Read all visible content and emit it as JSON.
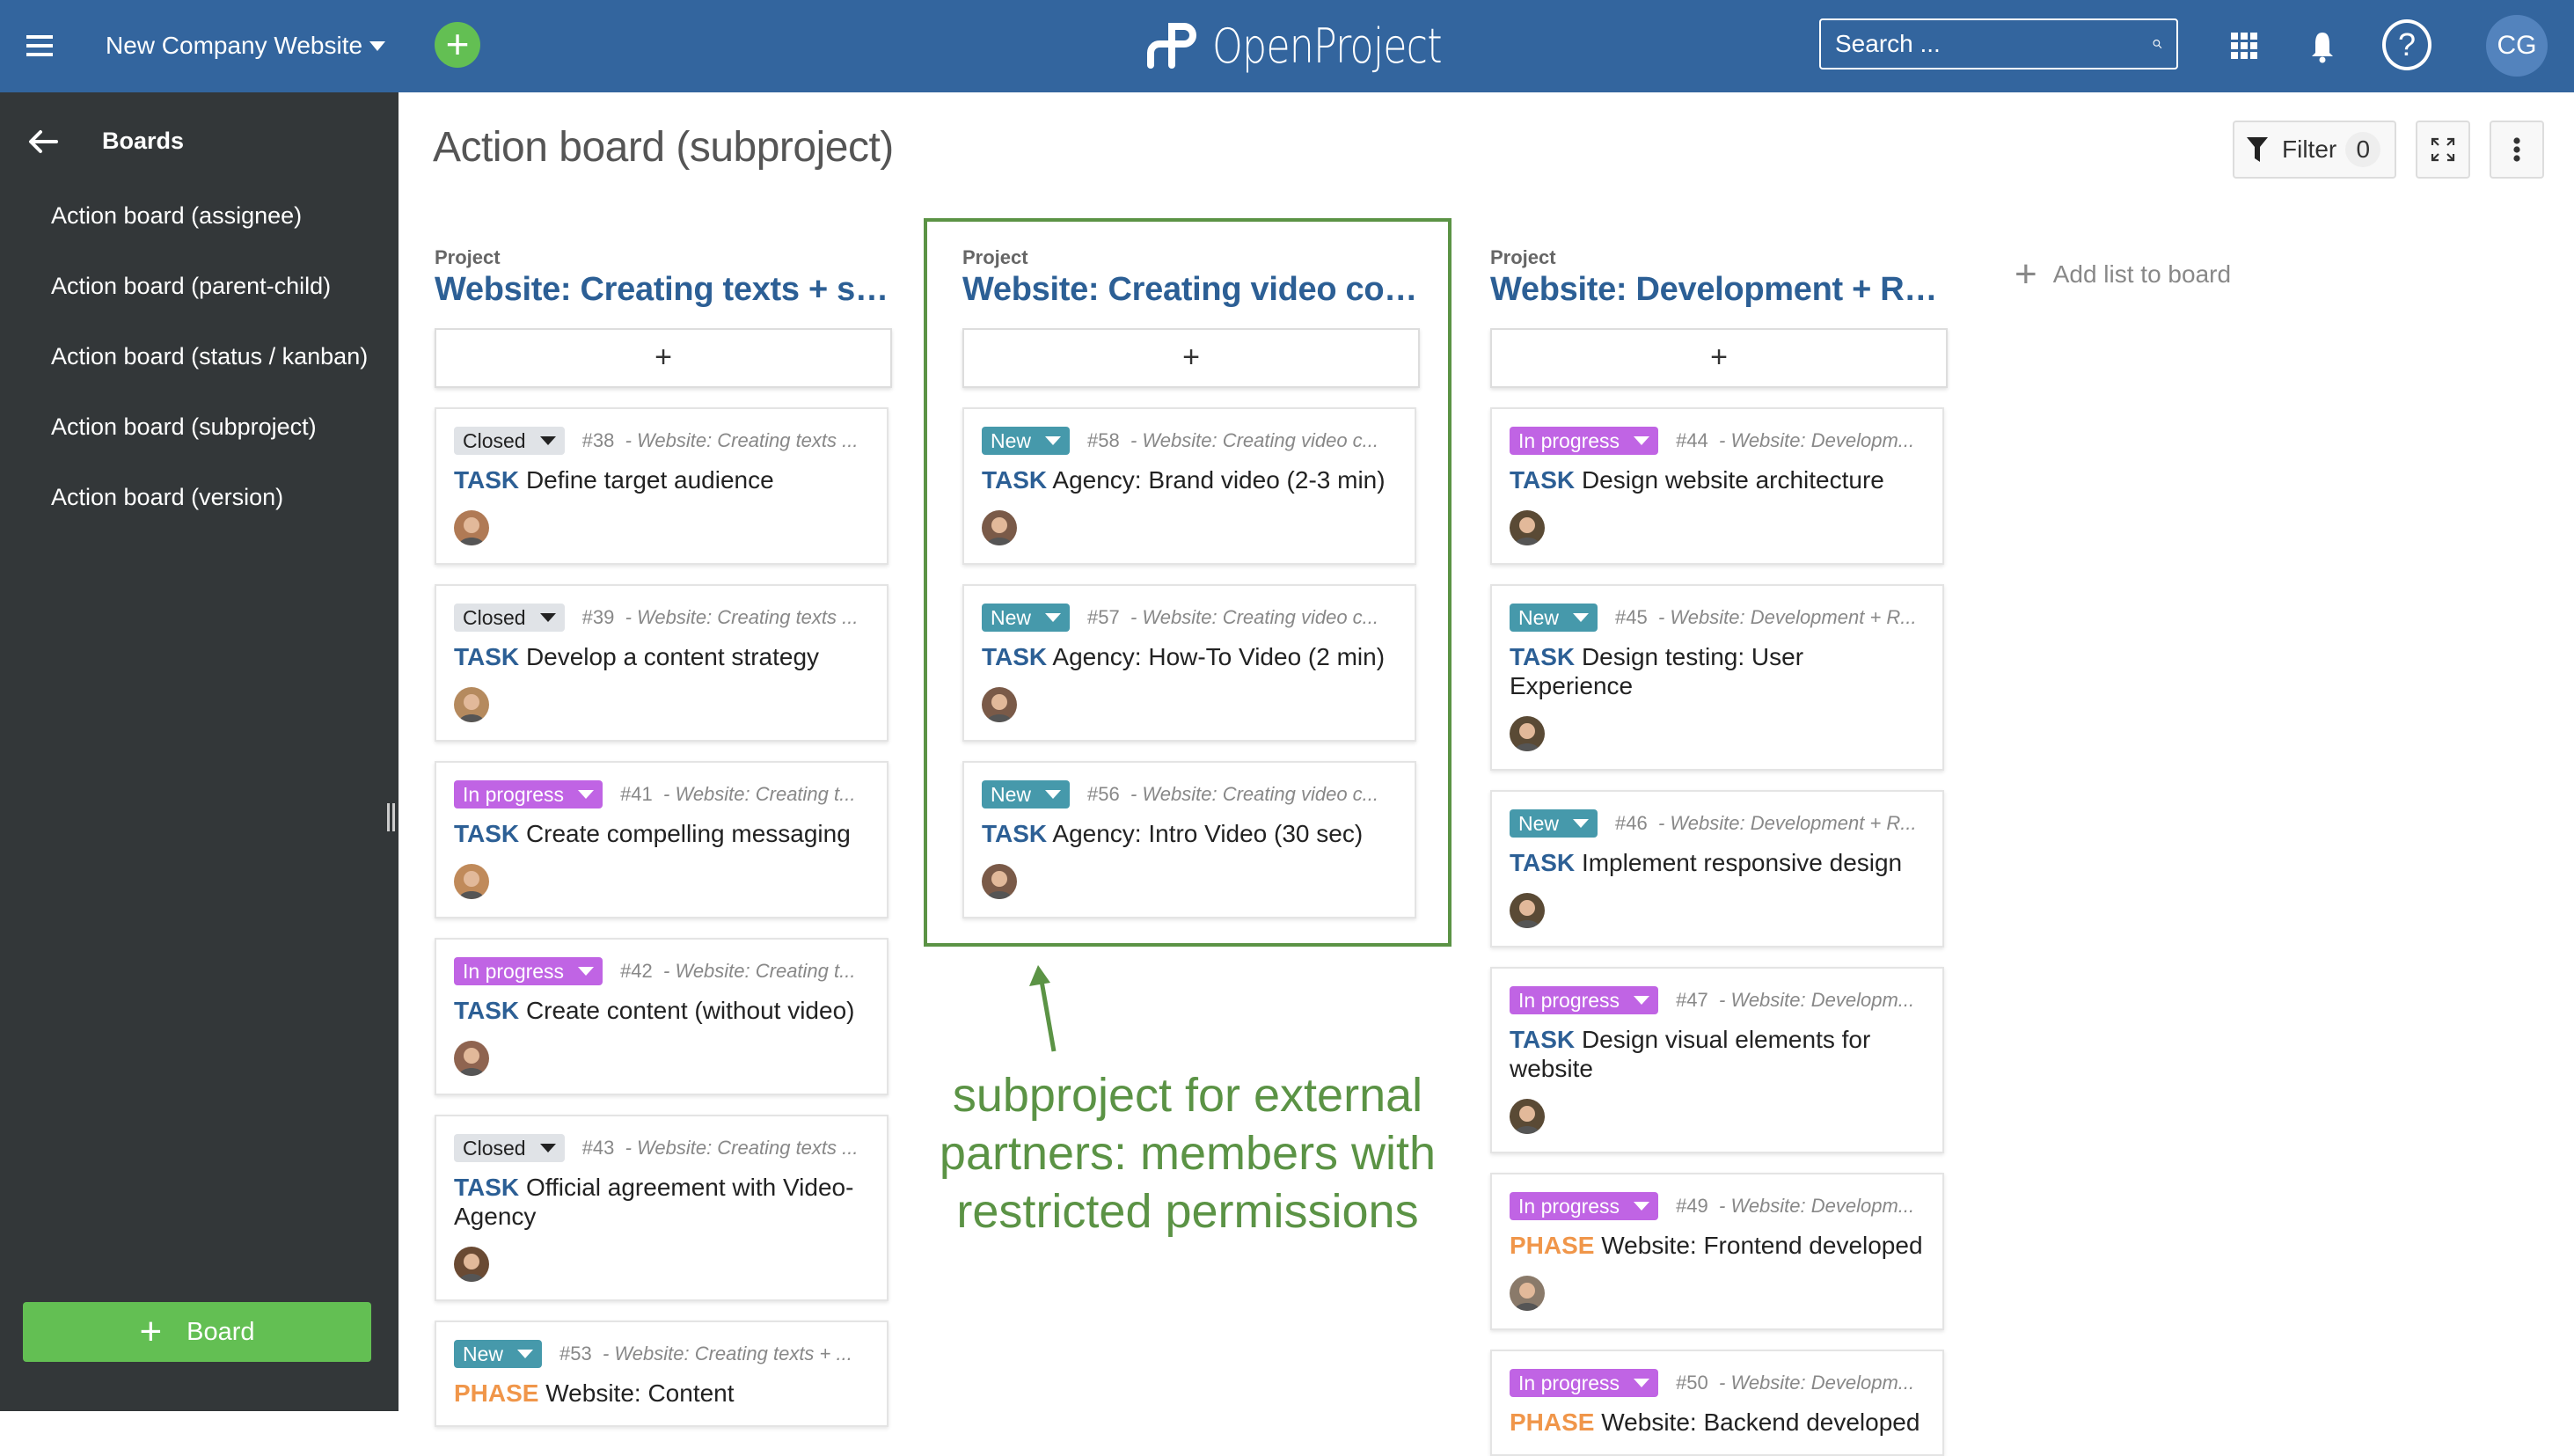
{
  "header": {
    "project_name": "New Company Website",
    "logo_text": "OpenProject",
    "search_placeholder": "Search ...",
    "help_label": "?",
    "user_initials": "CG"
  },
  "sidebar": {
    "title": "Boards",
    "items": [
      {
        "label": "Action board (assignee)"
      },
      {
        "label": "Action board (parent-child)"
      },
      {
        "label": "Action board (status / kanban)"
      },
      {
        "label": "Action board (subproject)"
      },
      {
        "label": "Action board (version)"
      }
    ],
    "new_board_label": "Board"
  },
  "page": {
    "title": "Action board (subproject)",
    "filter_label": "Filter",
    "filter_count": "0",
    "add_list_label": "Add list to board"
  },
  "columns": [
    {
      "label": "Project",
      "title": "Website: Creating texts + structure",
      "cards": [
        {
          "status": "Closed",
          "status_type": "closed",
          "id": "#38",
          "project": "- Website: Creating texts ...",
          "type": "TASK",
          "type_class": "task",
          "subject": "Define target audience",
          "avatar_color": "#b07a55"
        },
        {
          "status": "Closed",
          "status_type": "closed",
          "id": "#39",
          "project": "- Website: Creating texts ...",
          "type": "TASK",
          "type_class": "task",
          "subject": "Develop a content strategy",
          "avatar_color": "#b58a5e"
        },
        {
          "status": "In progress",
          "status_type": "inprogress",
          "id": "#41",
          "project": "- Website: Creating t...",
          "type": "TASK",
          "type_class": "task",
          "subject": "Create compelling messaging",
          "avatar_color": "#c08a5a"
        },
        {
          "status": "In progress",
          "status_type": "inprogress",
          "id": "#42",
          "project": "- Website: Creating t...",
          "type": "TASK",
          "type_class": "task",
          "subject": "Create content (without video)",
          "avatar_color": "#8f6450"
        },
        {
          "status": "Closed",
          "status_type": "closed",
          "id": "#43",
          "project": "- Website: Creating texts ...",
          "type": "TASK",
          "type_class": "task",
          "subject": "Official agreement with Video-Agency",
          "avatar_color": "#6a4a33"
        },
        {
          "status": "New",
          "status_type": "new",
          "id": "#53",
          "project": "- Website: Creating texts + ...",
          "type": "PHASE",
          "type_class": "phase",
          "subject": "Website: Content",
          "avatar_color": ""
        }
      ]
    },
    {
      "label": "Project",
      "title": "Website: Creating video content",
      "cards": [
        {
          "status": "New",
          "status_type": "new",
          "id": "#58",
          "project": "- Website: Creating video c...",
          "type": "TASK",
          "type_class": "task",
          "subject": "Agency: Brand video (2-3 min)",
          "avatar_color": "#7a5a48"
        },
        {
          "status": "New",
          "status_type": "new",
          "id": "#57",
          "project": "- Website: Creating video c...",
          "type": "TASK",
          "type_class": "task",
          "subject": "Agency: How-To Video (2 min)",
          "avatar_color": "#7a5a48"
        },
        {
          "status": "New",
          "status_type": "new",
          "id": "#56",
          "project": "- Website: Creating video c...",
          "type": "TASK",
          "type_class": "task",
          "subject": "Agency: Intro Video (30 sec)",
          "avatar_color": "#7a5a48"
        }
      ]
    },
    {
      "label": "Project",
      "title": "Website: Development + Rollout",
      "cards": [
        {
          "status": "In progress",
          "status_type": "inprogress",
          "id": "#44",
          "project": "- Website: Developm...",
          "type": "TASK",
          "type_class": "task",
          "subject": "Design website architecture",
          "avatar_color": "#5a4a35"
        },
        {
          "status": "New",
          "status_type": "new",
          "id": "#45",
          "project": "- Website: Development + R...",
          "type": "TASK",
          "type_class": "task",
          "subject": "Design testing: User Experience",
          "avatar_color": "#5a4a35"
        },
        {
          "status": "New",
          "status_type": "new",
          "id": "#46",
          "project": "- Website: Development + R...",
          "type": "TASK",
          "type_class": "task",
          "subject": "Implement responsive design",
          "avatar_color": "#5a4a35"
        },
        {
          "status": "In progress",
          "status_type": "inprogress",
          "id": "#47",
          "project": "- Website: Developm...",
          "type": "TASK",
          "type_class": "task",
          "subject": "Design visual elements for website",
          "avatar_color": "#5a4a35"
        },
        {
          "status": "In progress",
          "status_type": "inprogress",
          "id": "#49",
          "project": "- Website: Developm...",
          "type": "PHASE",
          "type_class": "phase",
          "subject": "Website: Frontend developed",
          "avatar_color": "#8a7a6a"
        },
        {
          "status": "In progress",
          "status_type": "inprogress",
          "id": "#50",
          "project": "- Website: Developm...",
          "type": "PHASE",
          "type_class": "phase",
          "subject": "Website: Backend developed",
          "avatar_color": ""
        }
      ]
    }
  ],
  "annotation": {
    "text": "subproject for external partners: members with restricted permissions",
    "color": "#5b9345"
  },
  "colors": {
    "header": "#33659e",
    "sidebar": "#333739",
    "accent_green": "#63bf53",
    "status_new": "#4699ab",
    "status_in_progress": "#c064e4",
    "status_closed": "#e0e3e7",
    "type_task": "#2c5f95",
    "type_phase": "#f0964a"
  }
}
